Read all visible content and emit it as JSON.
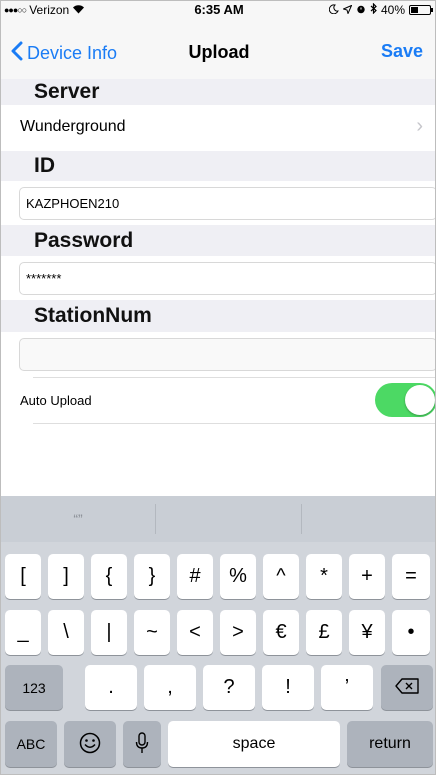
{
  "status_bar": {
    "signal": "●●●○○",
    "carrier": "Verizon",
    "wifi_icon": "wifi-icon",
    "time": "6:35 AM",
    "battery_pct": "40%",
    "battery_level": 0.4
  },
  "nav": {
    "back_label": "Device Info",
    "title": "Upload",
    "save_label": "Save"
  },
  "sections": {
    "server_header": "Server",
    "server_value": "Wunderground",
    "id_header": "ID",
    "id_value": "KAZPHOEN210",
    "password_header": "Password",
    "password_value": "*******",
    "stationnum_header": "StationNum",
    "stationnum_value": "",
    "auto_upload_label": "Auto Upload",
    "auto_upload_on": true
  },
  "keyboard": {
    "predictive": [
      "“”",
      "",
      ""
    ],
    "row1": [
      "[",
      "]",
      "{",
      "}",
      "#",
      "%",
      "^",
      "*",
      "+",
      "="
    ],
    "row2": [
      "_",
      "\\",
      "|",
      "~",
      "<",
      ">",
      "€",
      "£",
      "¥",
      "•"
    ],
    "row3_left": "123",
    "row3_keys": [
      ".",
      ",",
      "?",
      "!",
      "’"
    ],
    "row4_abc": "ABC",
    "space_label": "space",
    "return_label": "return"
  },
  "colors": {
    "accent": "#1a7cf5",
    "toggle_on": "#4cd964",
    "section_bg": "#efeff4",
    "keyboard_bg": "#d1d5db"
  }
}
